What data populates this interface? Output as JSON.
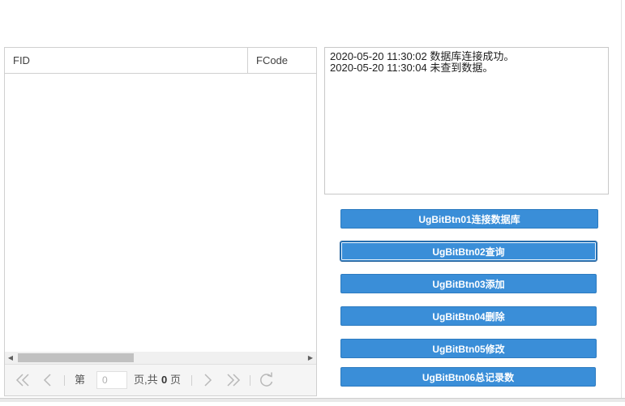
{
  "grid": {
    "columns": [
      {
        "label": "FID"
      },
      {
        "label": "FCode"
      }
    ],
    "rows": []
  },
  "pager": {
    "page_prefix": "第",
    "page_value": "0",
    "page_suffix": "页,共",
    "total_pages": "0",
    "total_suffix": "页"
  },
  "log": {
    "lines": [
      "2020-05-20 11:30:02 数据库连接成功。",
      "2020-05-20 11:30:04 未查到数据。"
    ]
  },
  "buttons": {
    "btn01": "UgBitBtn01连接数据库",
    "btn02": "UgBitBtn02查询",
    "btn03": "UgBitBtn03添加",
    "btn04": "UgBitBtn04删除",
    "btn05": "UgBitBtn05修改",
    "btn06": "UgBitBtn06总记录数"
  },
  "colors": {
    "button_bg": "#3a8ed8",
    "button_text": "#ffffff"
  },
  "icons": {
    "first": "double-chevron-left-icon",
    "prev": "chevron-left-icon",
    "next": "chevron-right-icon",
    "last": "double-chevron-right-icon",
    "refresh": "refresh-icon"
  }
}
